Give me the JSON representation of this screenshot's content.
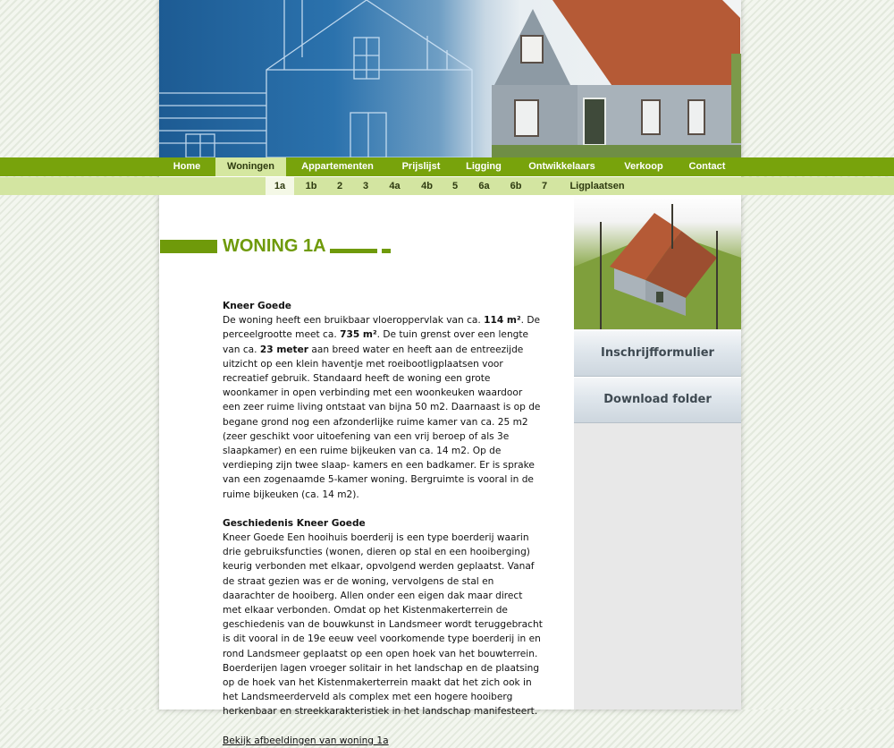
{
  "nav": {
    "main": [
      {
        "label": "Home",
        "active": false
      },
      {
        "label": "Woningen",
        "active": true
      },
      {
        "label": "Appartementen",
        "active": false
      },
      {
        "label": "Prijslijst",
        "active": false
      },
      {
        "label": "Ligging",
        "active": false
      },
      {
        "label": "Ontwikkelaars",
        "active": false
      },
      {
        "label": "Verkoop",
        "active": false
      },
      {
        "label": "Contact",
        "active": false
      }
    ],
    "sub": [
      {
        "label": "1a",
        "active": true
      },
      {
        "label": "1b",
        "active": false
      },
      {
        "label": "2",
        "active": false
      },
      {
        "label": "3",
        "active": false
      },
      {
        "label": "4a",
        "active": false
      },
      {
        "label": "4b",
        "active": false
      },
      {
        "label": "5",
        "active": false
      },
      {
        "label": "6a",
        "active": false
      },
      {
        "label": "6b",
        "active": false
      },
      {
        "label": "7",
        "active": false
      },
      {
        "label": "Ligplaatsen",
        "active": false
      }
    ]
  },
  "page": {
    "title": "WONING 1A",
    "intro_heading": "Kneer Goede",
    "intro": {
      "t1": "De woning heeft een bruikbaar vloeroppervlak van ca. ",
      "b1": "114 m²",
      "t2": ". De perceelgrootte meet ca. ",
      "b2": "735 m²",
      "t3": ". De tuin grenst over een lengte van ca. ",
      "b3": "23 meter",
      "t4": " aan breed water en heeft aan de entreezijde uitzicht op een klein haventje met roeibootligplaatsen voor recreatief gebruik. Standaard heeft de woning een grote woonkamer in open verbinding met een woonkeuken waardoor een zeer ruime living ontstaat van bijna 50 m2. Daarnaast is op de begane grond nog een afzonderlijke ruime kamer van ca. 25 m2 (zeer geschikt voor uitoefening van een vrij beroep of als 3e slaapkamer) en een ruime bijkeuken van ca. 14 m2. Op de verdieping zijn twee slaap- kamers en een badkamer. Er is sprake van een zogenaamde 5-kamer woning. Bergruimte is vooral in de ruime bijkeuken (ca. 14 m2)."
    },
    "history_heading": "Geschiedenis Kneer Goede",
    "history_text": "Kneer Goede Een hooihuis boerderij is een type boerderij waarin drie gebruiksfuncties (wonen, dieren op stal en een hooiberging) keurig verbonden met elkaar, opvolgend werden geplaatst. Vanaf de straat gezien was er de woning, vervolgens de stal en daarachter de hooiberg. Allen onder een eigen dak maar direct met elkaar verbonden. Omdat op het Kistenmakerterrein de geschiedenis van de bouwkunst in Landsmeer wordt teruggebracht is dit vooral in de 19e eeuw veel voorkomende type boerderij in en rond Landsmeer geplaatst op een open hoek van het bouwterrein. Boerderijen lagen vroeger solitair in het landschap en de plaatsing op de hoek van het Kistenmakerterrein maakt dat het zich ook in het Landsmeerderveld als complex met een hogere hooiberg herkenbaar en streekkarakteristiek in het landschap manifesteert.",
    "link": "Bekijk afbeeldingen van woning 1a"
  },
  "sidebar": {
    "buttons": [
      "Inschrijfformulier",
      "Download folder"
    ]
  },
  "colors": {
    "nav_green": "#78a30c",
    "subnav_green": "#d3e5a1",
    "title_green": "#6f9a0a"
  }
}
